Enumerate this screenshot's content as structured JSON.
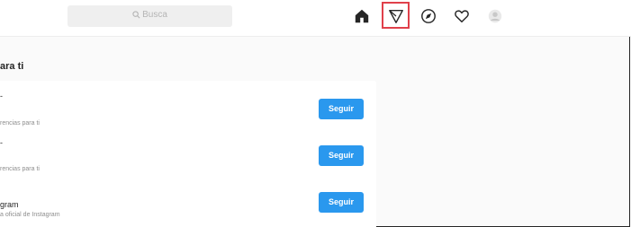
{
  "colors": {
    "accent": "#2a98ee",
    "highlight": "#e0404a",
    "topbar_bg": "#ffffff",
    "page_bg": "#fafafa"
  },
  "search": {
    "placeholder": "Busca",
    "icon": "search-icon"
  },
  "nav": {
    "icons": [
      "home-icon",
      "direct-icon",
      "explore-icon",
      "heart-icon",
      "avatar-icon"
    ],
    "highlighted": "direct-icon"
  },
  "section": {
    "title": "ara ti"
  },
  "suggestions": [
    {
      "name": "-",
      "subtitle": "rencias para ti",
      "button": "Seguir"
    },
    {
      "name": "-",
      "subtitle": "rencias para ti",
      "button": "Seguir"
    },
    {
      "name": "gram",
      "subtitle": "a oficial de Instagram",
      "button": "Seguir"
    }
  ]
}
